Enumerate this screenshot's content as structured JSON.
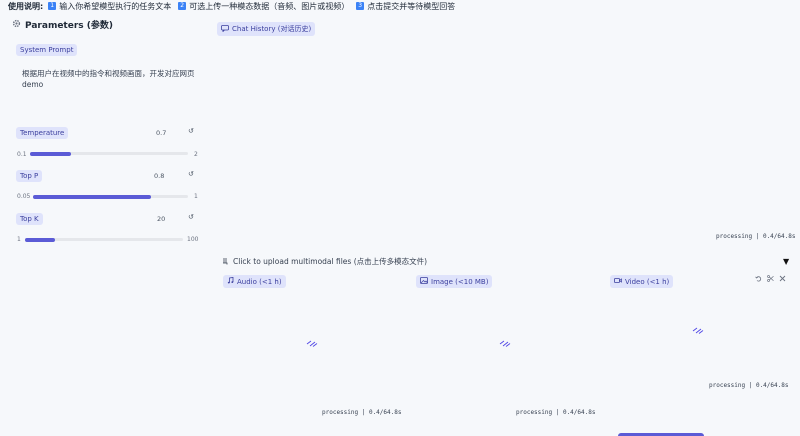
{
  "usage": {
    "label": "使用说明:",
    "steps": [
      {
        "num": "1",
        "text": "输入你希望模型执行的任务文本"
      },
      {
        "num": "2",
        "text": "可选上传一种模态数据（音频、图片或视频）"
      },
      {
        "num": "3",
        "text": "点击提交并等待模型回答"
      }
    ]
  },
  "params": {
    "title": "Parameters (参数)",
    "system_prompt": {
      "label": "System Prompt",
      "value": "根据用户在视频中的指令和视频画面，开发对应网页demo"
    },
    "temperature": {
      "label": "Temperature",
      "value": "0.7",
      "min": "0.1",
      "max": "2",
      "fraction": 0.26
    },
    "top_p": {
      "label": "Top P",
      "value": "0.8",
      "min": "0.05",
      "max": "1",
      "fraction": 0.76
    },
    "top_k": {
      "label": "Top K",
      "value": "20",
      "min": "1",
      "max": "100",
      "fraction": 0.19
    },
    "reset_glyph": "↺"
  },
  "chat": {
    "label": "Chat History (对话历史)",
    "status": "processing | 0.4/64.8s"
  },
  "upload": {
    "header": "Click to upload multimodal files (点击上传多模态文件)",
    "toggle": "▼",
    "audio": {
      "label": "Audio (<1 h)",
      "status": "processing | 0.4/64.8s"
    },
    "image": {
      "label": "Image (<10 MB)",
      "status": "processing | 0.4/64.8s"
    },
    "video": {
      "label": "Video (<1 h)",
      "status": "processing | 0.4/64.8s"
    }
  }
}
